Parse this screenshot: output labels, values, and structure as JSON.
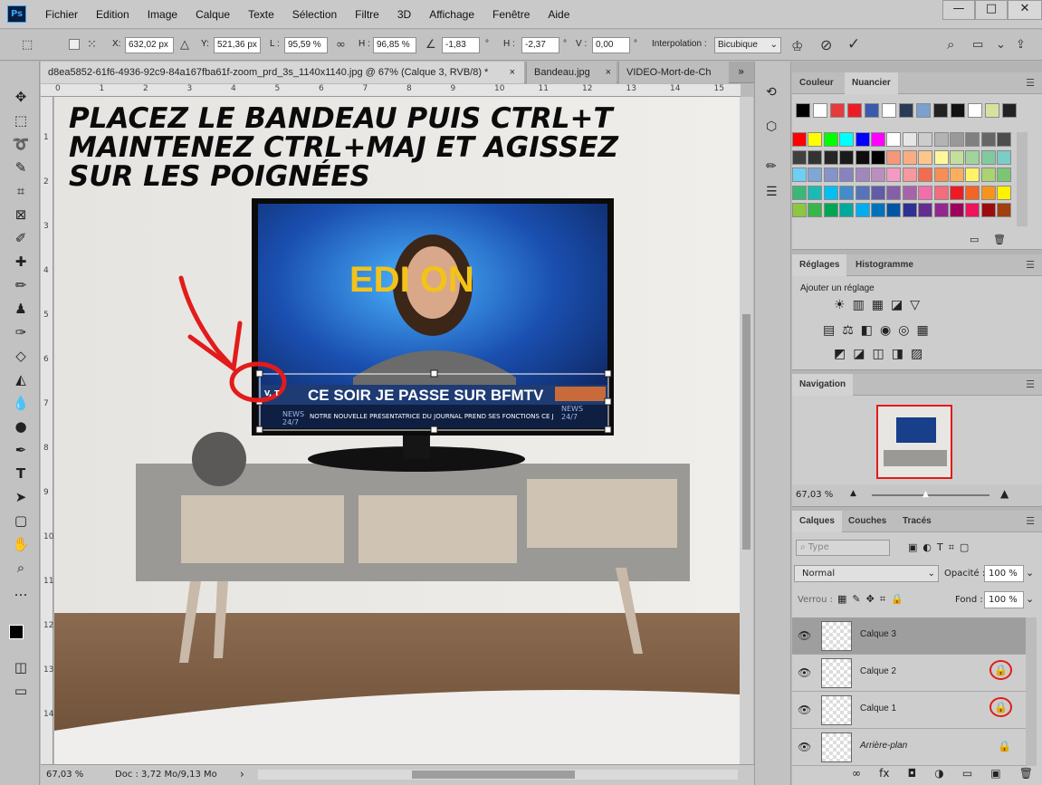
{
  "app": {
    "logo": "Ps"
  },
  "menu": [
    "Fichier",
    "Edition",
    "Image",
    "Calque",
    "Texte",
    "Sélection",
    "Filtre",
    "3D",
    "Affichage",
    "Fenêtre",
    "Aide"
  ],
  "window_controls": {
    "minimize": "—",
    "maximize": "□",
    "close": "✕"
  },
  "options": {
    "x_label": "X:",
    "x_value": "632,02 px",
    "y_label": "Y:",
    "y_value": "521,36 px",
    "l_label": "L :",
    "l_value": "95,59 %",
    "h_label": "H :",
    "h_value": "96,85 %",
    "angle_value": "-1,83",
    "deg": "°",
    "hskew_label": "H :",
    "hskew_value": "-2,37",
    "vskew_label": "V :",
    "vskew_value": "0,00",
    "interp_label": "Interpolation :",
    "interp_value": "Bicubique"
  },
  "tabs": {
    "active": "d8ea5852-61f6-4936-92c9-84a167fba61f-zoom_prd_3s_1140x1140.jpg @ 67% (Calque 3, RVB/8) *",
    "second": "Bandeau.jpg",
    "third": "VIDEO-Mort-de-Ch",
    "close": "×",
    "more": "»"
  },
  "ruler_top": [
    "0",
    "1",
    "2",
    "3",
    "4",
    "5",
    "6",
    "7",
    "8",
    "9",
    "10",
    "11",
    "12",
    "13",
    "14",
    "15"
  ],
  "ruler_left": [
    "1",
    "2",
    "3",
    "4",
    "5",
    "6",
    "7",
    "8",
    "9",
    "10",
    "11",
    "12",
    "13",
    "14"
  ],
  "canvas": {
    "annotation": [
      "PLACEZ LE BANDEAU PUIS CTRL+T",
      "MAINTENEZ CTRL+MAJ ET AGISSEZ",
      "SUR LES POIGNÉES"
    ],
    "tv_banner": "CE SOIR JE PASSE SUR BFMTV",
    "tv_ticker": "NOTRE NOUVELLE PRÉSENTATRICE DU JOURNAL PREND SES FONCTIONS CE JOUR MÊME...",
    "tv_news": "NEWS 24/7",
    "tv_edition": "EDI ON",
    "tv_left_tag": "V, T"
  },
  "status": {
    "zoom": "67,03 %",
    "doc": "Doc : 3,72 Mo/9,13 Mo",
    "arrow": "›"
  },
  "color_panel": {
    "tabs": [
      "Couleur",
      "Nuancier"
    ],
    "recent": [
      "#000000",
      "#ffffff",
      "#e63b3b",
      "#ed1c24",
      "#3a5bab",
      "#ffffff",
      "#2a3b55",
      "#7aa0d0",
      "#222222",
      "#111111",
      "#ffffff",
      "#d4e4a0",
      "#222222"
    ],
    "grid": [
      [
        "#ff0000",
        "#ffff00",
        "#00ff00",
        "#00ffff",
        "#0000ff",
        "#ff00ff",
        "#ffffff",
        "#e6e6e6",
        "#cccccc",
        "#b3b3b3",
        "#999999",
        "#808080",
        "#666666",
        "#4d4d4d"
      ],
      [
        "#404040",
        "#333333",
        "#262626",
        "#1a1a1a",
        "#0d0d0d",
        "#000000",
        "#f7977a",
        "#f9ad81",
        "#fdc68a",
        "#fff79a",
        "#c4df9b",
        "#a2d39c",
        "#82ca9d",
        "#7bcdc8"
      ],
      [
        "#6ecff6",
        "#7ea7d8",
        "#8493ca",
        "#8882be",
        "#a187be",
        "#bc8dbf",
        "#f49ac2",
        "#f6989d",
        "#f26c4f",
        "#f68e55",
        "#fbaf5c",
        "#fff467",
        "#acd372",
        "#7cc576"
      ],
      [
        "#3bb878",
        "#1abbb4",
        "#00bff3",
        "#438ccb",
        "#5574b9",
        "#605ca8",
        "#855fa8",
        "#a763a8",
        "#f06ea9",
        "#f26d7d",
        "#ed1c24",
        "#f26522",
        "#f7941d",
        "#fff200"
      ],
      [
        "#8dc73f",
        "#39b54a",
        "#00a651",
        "#00a99d",
        "#00aeef",
        "#0072bc",
        "#0054a6",
        "#2e3192",
        "#662d91",
        "#92278f",
        "#9e005d",
        "#ed145b",
        "#9e0b0f",
        "#a0410d"
      ]
    ]
  },
  "adjust_panel": {
    "tabs": [
      "Réglages",
      "Histogramme"
    ],
    "add": "Ajouter un réglage",
    "row1": [
      "☀",
      "▥",
      "▦",
      "◪",
      "▽"
    ],
    "row2": [
      "▤",
      "⚖",
      "◧",
      "◉",
      "◎",
      "▦"
    ],
    "row3": [
      "◩",
      "◪",
      "◫",
      "◨",
      "▨"
    ]
  },
  "nav_panel": {
    "tab": "Navigation",
    "zoom": "67,03 %"
  },
  "layers_panel": {
    "tabs": [
      "Calques",
      "Couches",
      "Tracés"
    ],
    "kind": "Type",
    "blend": "Normal",
    "opacity_label": "Opacité :",
    "opacity": "100 %",
    "lock_label": "Verrou :",
    "fill_label": "Fond :",
    "fill": "100 %",
    "layers": [
      {
        "name": "Calque 3",
        "selected": true,
        "locked": false
      },
      {
        "name": "Calque 2",
        "selected": false,
        "locked": true
      },
      {
        "name": "Calque 1",
        "selected": false,
        "locked": true
      },
      {
        "name": "Arrière-plan",
        "selected": false,
        "locked": true,
        "italic": true
      }
    ],
    "footer": [
      "∞",
      "fx",
      "◘",
      "◑",
      "▭",
      "▣",
      "🗑"
    ]
  },
  "colors": {
    "accent_red": "#e21b1b",
    "selection": "#9e9e9e"
  }
}
